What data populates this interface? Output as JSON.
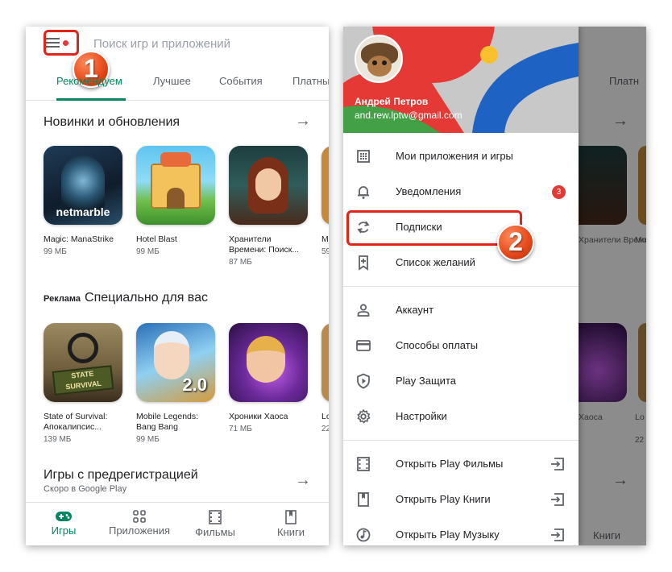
{
  "left_screen": {
    "search_placeholder": "Поиск игр и приложений",
    "callout_number": "1",
    "tabs": [
      {
        "label": "Рекомендуем",
        "active": true
      },
      {
        "label": "Лучшее",
        "active": false
      },
      {
        "label": "События",
        "active": false
      },
      {
        "label": "Платные",
        "active": false
      }
    ],
    "section1": {
      "title": "Новинки и обновления",
      "apps": [
        {
          "name": "Magic: ManaStrike",
          "size": "99 МБ",
          "icon_text": "netmarble"
        },
        {
          "name": "Hotel Blast",
          "size": "99 МБ",
          "icon_text": ""
        },
        {
          "name": "Хранители Времени: Поиск...",
          "size": "87 МБ",
          "icon_text": ""
        },
        {
          "name": "Mo Ва",
          "size": "59",
          "icon_text": ""
        }
      ]
    },
    "section2": {
      "ad_label": "Реклама",
      "title": "Специально для вас",
      "apps": [
        {
          "name": "State of Survival: Апокалипсис...",
          "size": "139 МБ",
          "icon_text": "STATE SURVIVAL"
        },
        {
          "name": "Mobile Legends: Bang Bang",
          "size": "99 МБ",
          "icon_text": "2.0"
        },
        {
          "name": "Хроники Хаоса",
          "size": "71 МБ",
          "icon_text": ""
        },
        {
          "name": "Lo Ko",
          "size": "22",
          "icon_text": ""
        }
      ]
    },
    "section3": {
      "title": "Игры с предрегистрацией",
      "subtitle": "Скоро в Google Play"
    },
    "bottom_nav": [
      {
        "label": "Игры",
        "icon": "gamepad-icon",
        "active": true
      },
      {
        "label": "Приложения",
        "icon": "apps-grid-icon",
        "active": false
      },
      {
        "label": "Фильмы",
        "icon": "film-icon",
        "active": false
      },
      {
        "label": "Книги",
        "icon": "book-icon",
        "active": false
      }
    ]
  },
  "right_screen": {
    "callout_number": "2",
    "user": {
      "name": "Андрей Петров",
      "email": "and.rew.lptw@gmail.com"
    },
    "menu_group1": [
      {
        "label": "Мои приложения и игры",
        "icon": "apps-icon"
      },
      {
        "label": "Уведомления",
        "icon": "bell-icon",
        "badge": "3"
      },
      {
        "label": "Подписки",
        "icon": "refresh-icon"
      },
      {
        "label": "Список желаний",
        "icon": "bookmark-plus-icon"
      }
    ],
    "menu_group2": [
      {
        "label": "Аккаунт",
        "icon": "person-icon"
      },
      {
        "label": "Способы оплаты",
        "icon": "credit-card-icon"
      },
      {
        "label": "Play Защита",
        "icon": "shield-play-icon"
      },
      {
        "label": "Настройки",
        "icon": "gear-icon"
      }
    ],
    "menu_group3": [
      {
        "label": "Открыть Play Фильмы",
        "icon": "film-icon"
      },
      {
        "label": "Открыть Play Книги",
        "icon": "book-icon"
      },
      {
        "label": "Открыть Play Музыку",
        "icon": "music-icon"
      }
    ],
    "background": {
      "tab_partial": "Платн",
      "app1_name": "Мо Ва",
      "app2_name": "Хранители Времени: Поиск...",
      "app3_name": "Хаоса",
      "app4_name": "Lo Ko",
      "app4_size": "22",
      "nav_label": "Книги"
    }
  },
  "colors": {
    "accent": "#01875f",
    "callout_red": "#e2231a",
    "badge_red": "#e53935"
  }
}
